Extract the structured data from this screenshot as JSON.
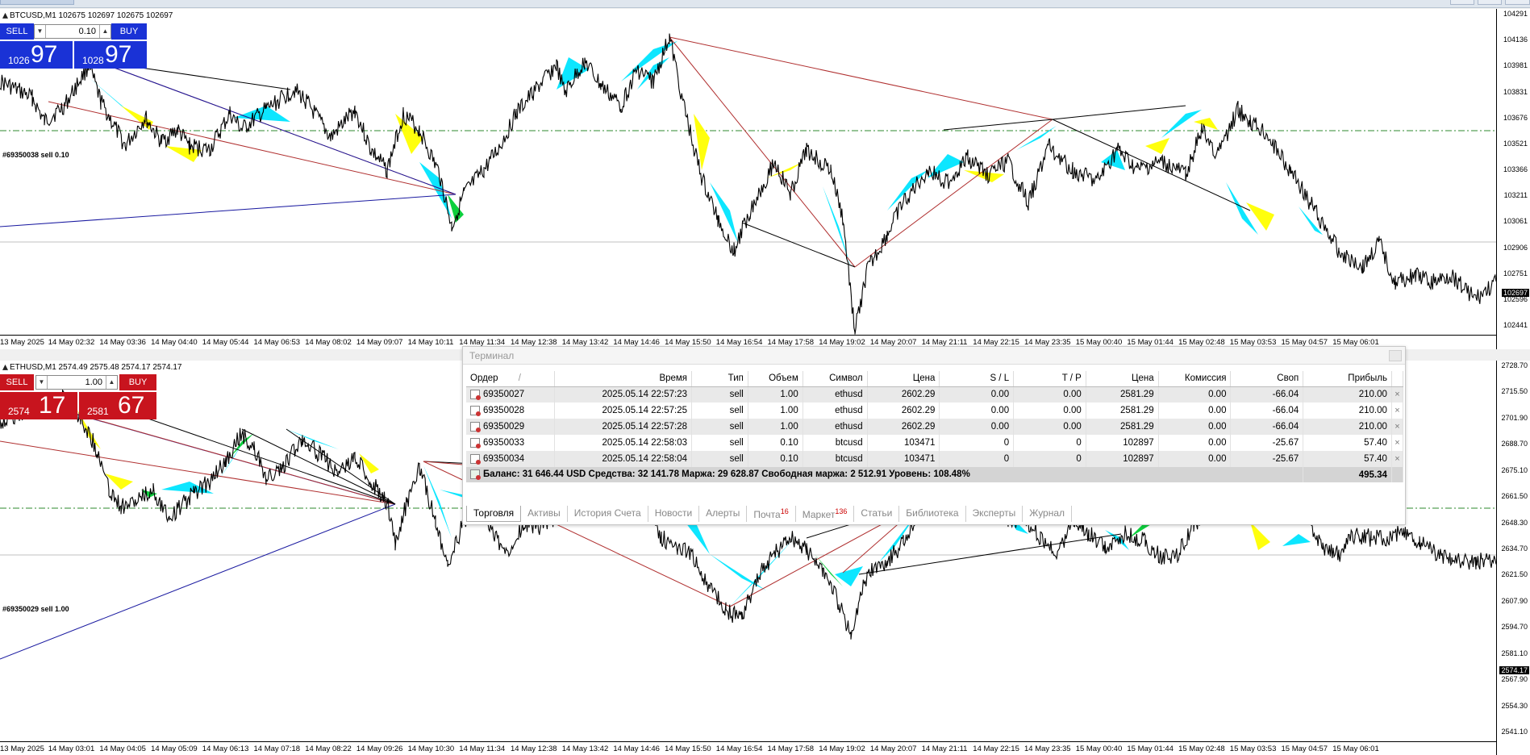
{
  "window": {
    "title": "Терминал"
  },
  "chart1": {
    "symbol_line": "BTCUSD,M1  102675 102697 102675 102697",
    "one_click": {
      "sell": "SELL",
      "buy": "BUY",
      "lot": "0.10",
      "sell_small": "1026",
      "sell_big": "97",
      "buy_small": "1028",
      "buy_big": "97"
    },
    "order_line": "#69350038 sell 0.10",
    "price_tag": "102697",
    "yticks": [
      "104291",
      "104136",
      "103981",
      "103831",
      "103676",
      "103521",
      "103366",
      "103211",
      "103061",
      "102906",
      "102751",
      "102596",
      "102441"
    ],
    "xticks": [
      "13 May 2025",
      "14 May 02:32",
      "14 May 03:36",
      "14 May 04:40",
      "14 May 05:44",
      "14 May 06:53",
      "14 May 08:02",
      "14 May 09:07",
      "14 May 10:11"
    ]
  },
  "chart2": {
    "symbol_line": "ETHUSD,M1  2574.49 2575.48 2574.17 2574.17",
    "one_click": {
      "sell": "SELL",
      "buy": "BUY",
      "lot": "1.00",
      "sell_small": "2574",
      "sell_big": "17",
      "buy_small": "2581",
      "buy_big": "67"
    },
    "order_line": "#69350029 sell 1.00",
    "price_tag": "2574.17",
    "yticks": [
      "2728.70",
      "2715.50",
      "2701.90",
      "2688.70",
      "2675.10",
      "2661.50",
      "2648.30",
      "2634.70",
      "2621.50",
      "2607.90",
      "2594.70",
      "2581.10",
      "2567.90",
      "2554.30",
      "2541.10"
    ],
    "xticks": [
      "13 May 2025",
      "14 May 03:01",
      "14 May 04:05",
      "14 May 05:09",
      "14 May 06:13",
      "14 May 07:18",
      "14 May 08:22",
      "14 May 09:26",
      "14 May 10:30",
      "14 May 11:34",
      "14 May 12:38",
      "14 May 13:42",
      "14 May 14:46",
      "14 May 15:50",
      "14 May 16:54",
      "14 May 17:58",
      "14 May 19:02",
      "14 May 20:07",
      "14 May 21:11",
      "14 May 22:15",
      "14 May 23:35",
      "15 May 00:40",
      "15 May 01:44",
      "15 May 02:48",
      "15 May 03:53",
      "15 May 04:57",
      "15 May 06:01"
    ]
  },
  "chart1_xticks_right": [
    "14 May 11:34",
    "14 May 12:38",
    "14 May 13:42",
    "14 May 14:46",
    "14 May 15:50",
    "14 May 16:54",
    "14 May 17:58",
    "14 May 19:02",
    "14 May 20:07",
    "14 May 21:11",
    "14 May 22:15",
    "14 May 23:35",
    "15 May 00:40",
    "15 May 01:44",
    "15 May 02:48",
    "15 May 03:53",
    "15 May 04:57",
    "15 May 06:01"
  ],
  "terminal": {
    "columns": [
      "Ордер",
      "Время",
      "Тип",
      "Объем",
      "Символ",
      "Цена",
      "S / L",
      "T / P",
      "Цена",
      "Комиссия",
      "Своп",
      "Прибыль"
    ],
    "sort_indicator": "/",
    "rows": [
      {
        "order": "69350027",
        "time": "2025.05.14 22:57:23",
        "type": "sell",
        "volume": "1.00",
        "symbol": "ethusd",
        "price": "2602.29",
        "sl": "0.00",
        "tp": "0.00",
        "cur": "2581.29",
        "commission": "0.00",
        "swap": "-66.04",
        "profit": "210.00"
      },
      {
        "order": "69350028",
        "time": "2025.05.14 22:57:25",
        "type": "sell",
        "volume": "1.00",
        "symbol": "ethusd",
        "price": "2602.29",
        "sl": "0.00",
        "tp": "0.00",
        "cur": "2581.29",
        "commission": "0.00",
        "swap": "-66.04",
        "profit": "210.00"
      },
      {
        "order": "69350029",
        "time": "2025.05.14 22:57:28",
        "type": "sell",
        "volume": "1.00",
        "symbol": "ethusd",
        "price": "2602.29",
        "sl": "0.00",
        "tp": "0.00",
        "cur": "2581.29",
        "commission": "0.00",
        "swap": "-66.04",
        "profit": "210.00"
      },
      {
        "order": "69350033",
        "time": "2025.05.14 22:58:03",
        "type": "sell",
        "volume": "0.10",
        "symbol": "btcusd",
        "price": "103471",
        "sl": "0",
        "tp": "0",
        "cur": "102897",
        "commission": "0.00",
        "swap": "-25.67",
        "profit": "57.40"
      },
      {
        "order": "69350034",
        "time": "2025.05.14 22:58:04",
        "type": "sell",
        "volume": "0.10",
        "symbol": "btcusd",
        "price": "103471",
        "sl": "0",
        "tp": "0",
        "cur": "102897",
        "commission": "0.00",
        "swap": "-25.67",
        "profit": "57.40"
      }
    ],
    "close_glyph": "×",
    "balance_line": "Баланс: 31 646.44 USD  Средства: 32 141.78  Маржа: 29 628.87  Свободная маржа: 2 512.91  Уровень: 108.48%",
    "total_profit": "495.34",
    "tabs": [
      {
        "label": "Торговля",
        "badge": ""
      },
      {
        "label": "Активы",
        "badge": ""
      },
      {
        "label": "История Счета",
        "badge": ""
      },
      {
        "label": "Новости",
        "badge": ""
      },
      {
        "label": "Алерты",
        "badge": ""
      },
      {
        "label": "Почта",
        "badge": "16"
      },
      {
        "label": "Маркет",
        "badge": "136"
      },
      {
        "label": "Статьи",
        "badge": ""
      },
      {
        "label": "Библиотека",
        "badge": ""
      },
      {
        "label": "Эксперты",
        "badge": ""
      },
      {
        "label": "Журнал",
        "badge": ""
      }
    ]
  },
  "colors": {
    "sell_bg": "#c8141e",
    "buy_bg_btc": "#1526c8",
    "zigzag_fill_a": "#00e5ff",
    "zigzag_fill_b": "#ffff00",
    "accent_green": "#00cc33",
    "order_line": "#007a00"
  }
}
